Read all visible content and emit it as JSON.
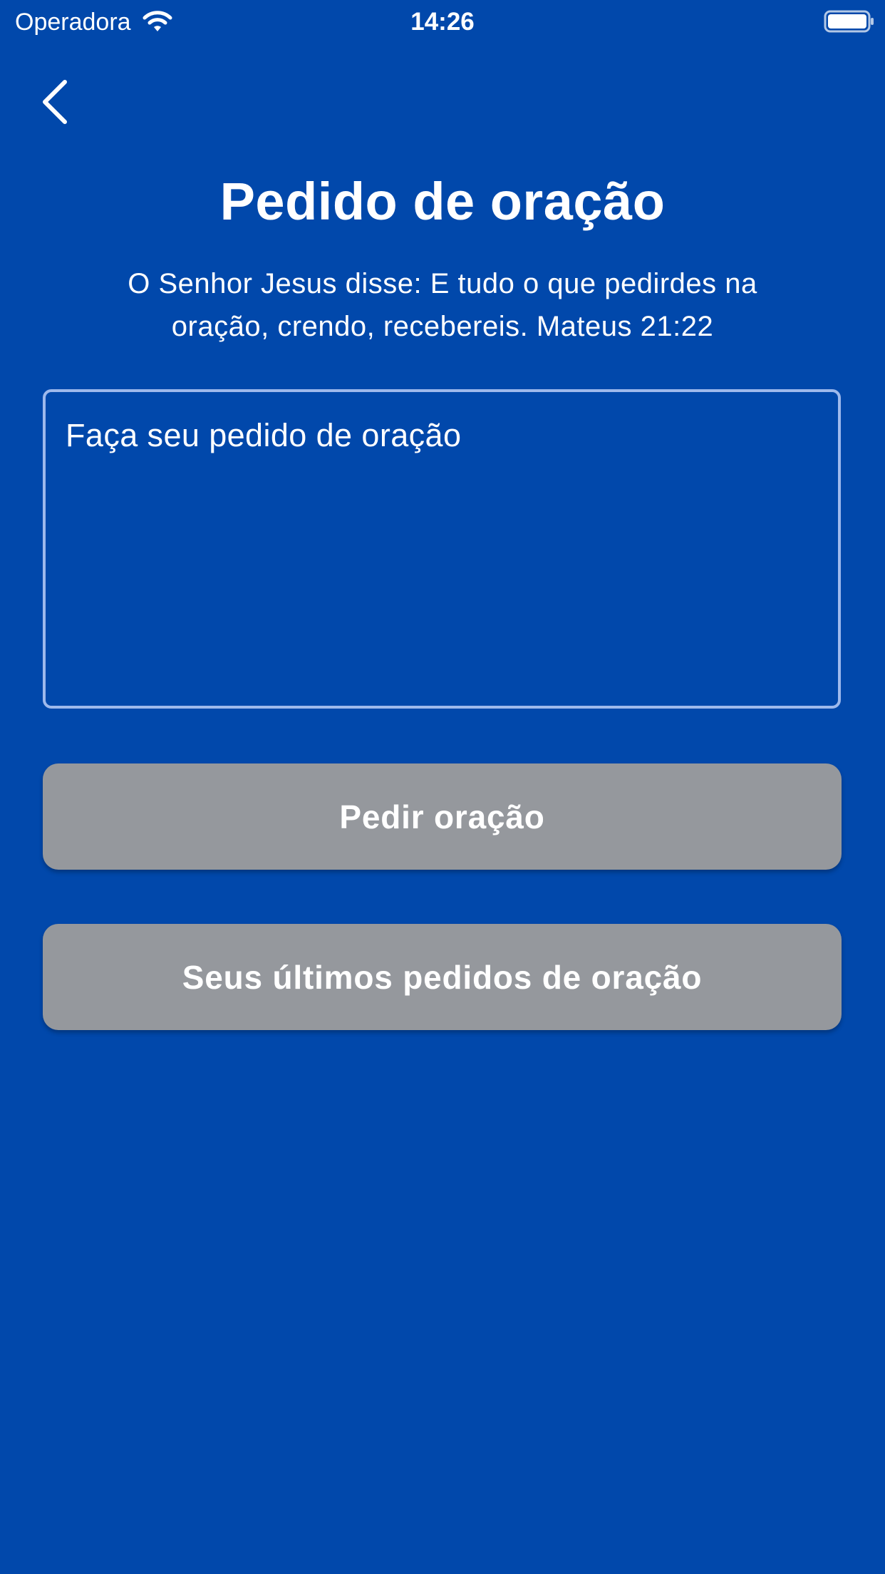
{
  "status_bar": {
    "carrier": "Operadora",
    "time": "14:26",
    "wifi_icon": "wifi-icon",
    "battery_icon": "battery-icon"
  },
  "nav": {
    "back_icon": "chevron-left-icon"
  },
  "page": {
    "title": "Pedido de oração",
    "verse": "O Senhor Jesus disse: E tudo o que pedirdes na oração, crendo, recebereis. Mateus 21:22"
  },
  "request_input": {
    "placeholder": "Faça seu pedido de oração",
    "value": ""
  },
  "buttons": {
    "request_label": "Pedir oração",
    "history_label": "Seus últimos pedidos de oração"
  },
  "colors": {
    "background": "#0148ab",
    "button": "#95989d",
    "input_border": "#9eb9ec",
    "text": "#ffffff"
  }
}
